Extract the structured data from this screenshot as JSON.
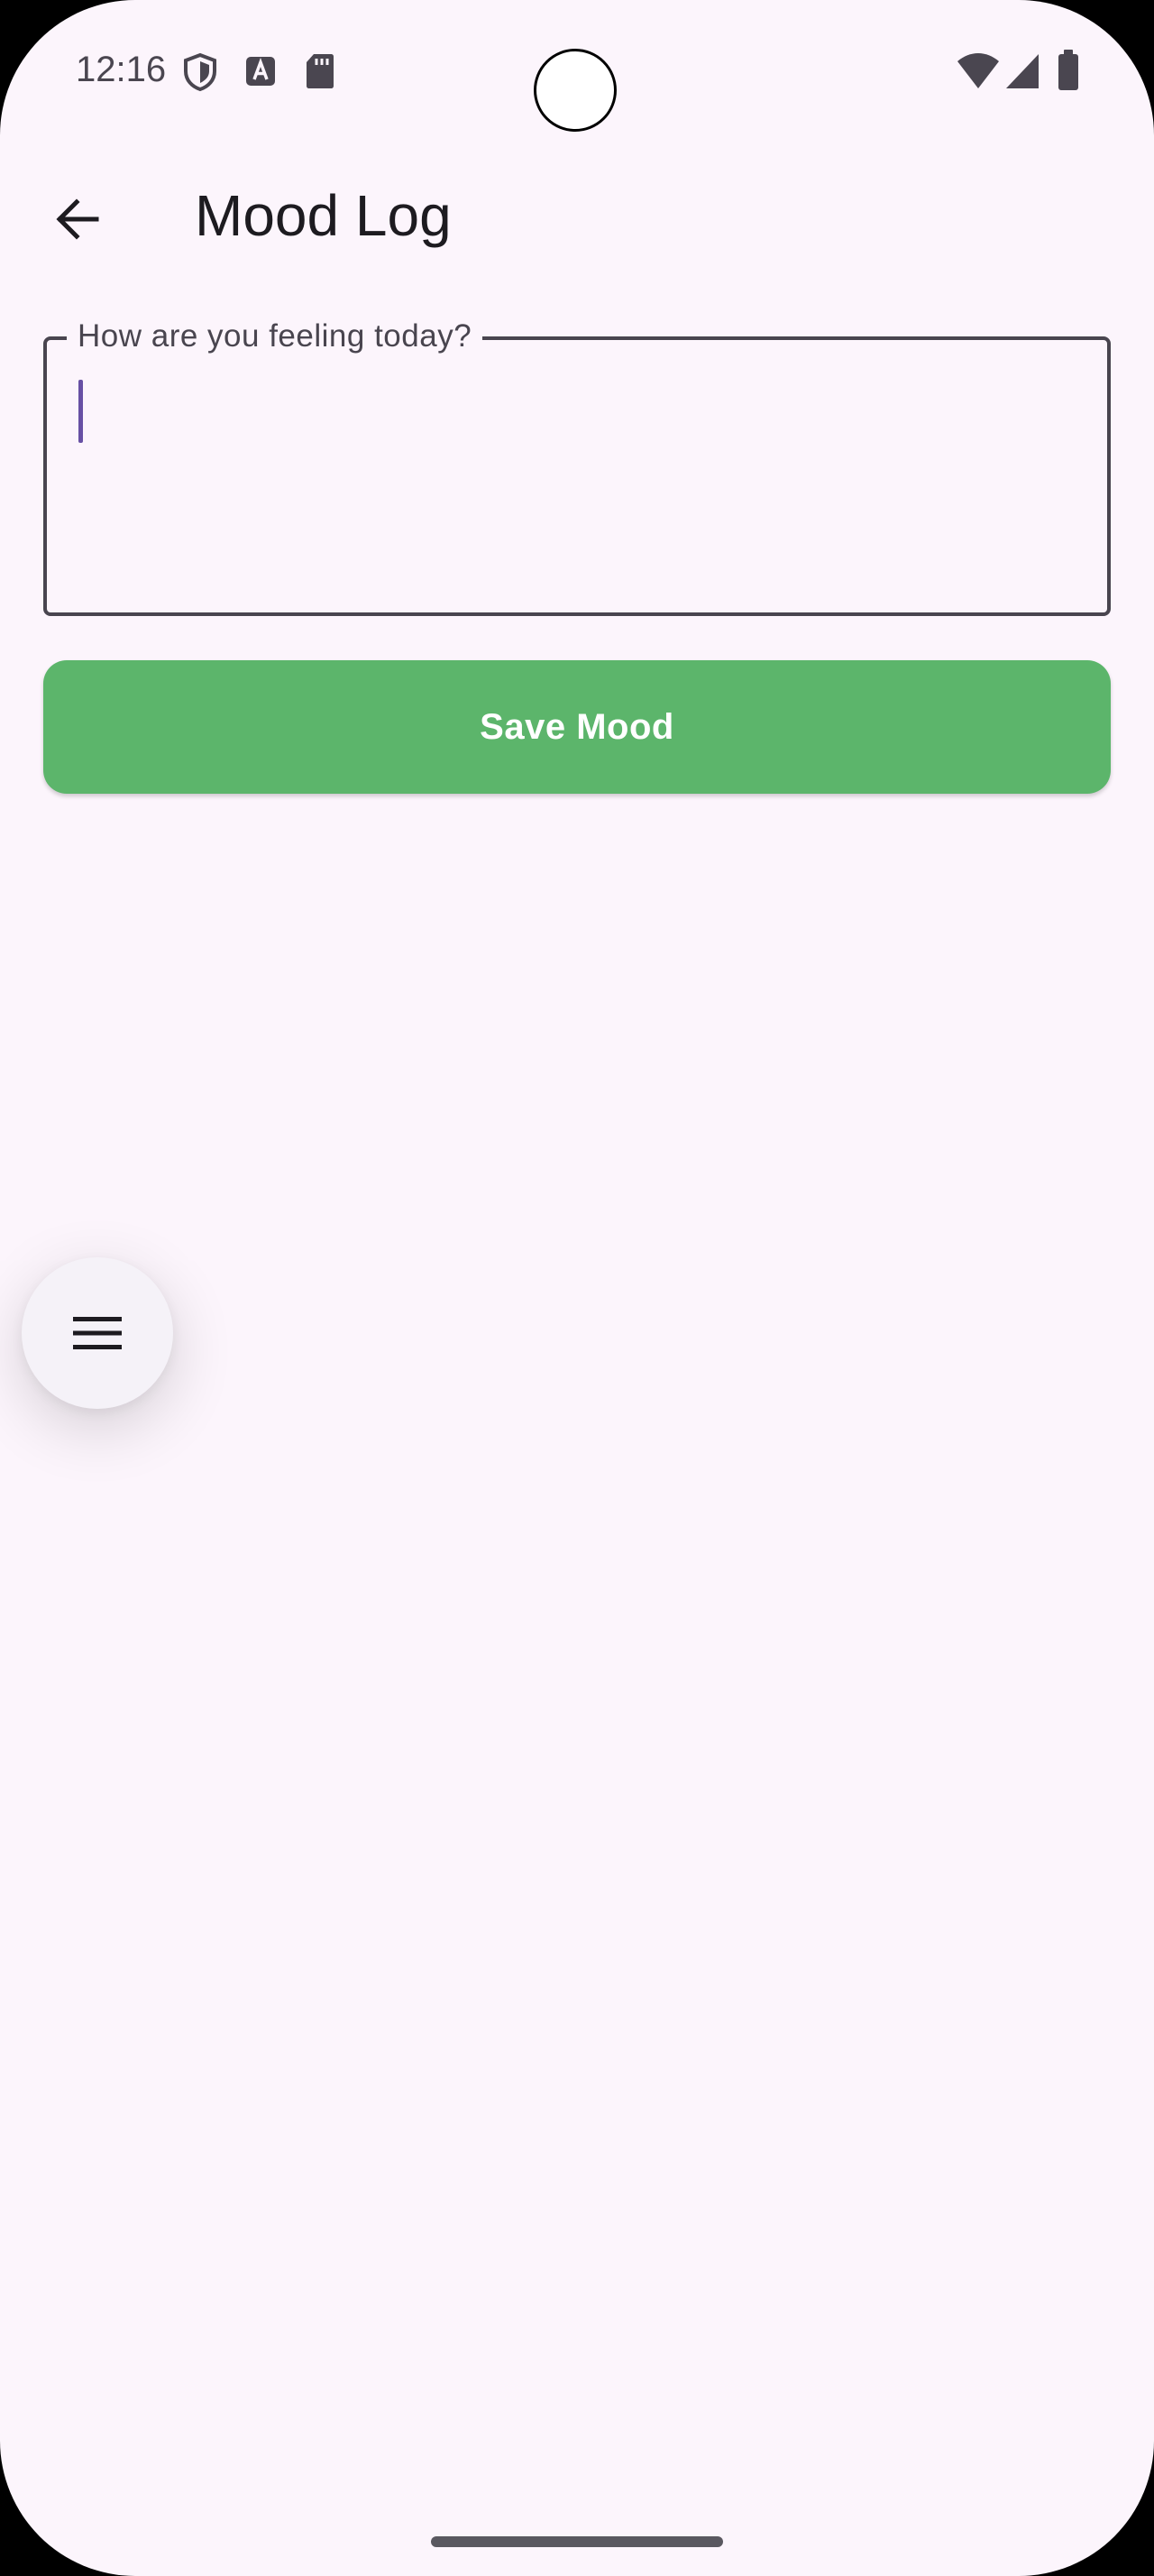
{
  "status_bar": {
    "time": "12:16",
    "left_icons": [
      "shield-icon",
      "text-app-icon",
      "sd-card-icon"
    ],
    "right_icons": [
      "wifi-icon",
      "cell-signal-icon",
      "battery-icon"
    ]
  },
  "app_bar": {
    "back_icon": "arrow-back-icon",
    "title": "Mood Log"
  },
  "mood_field": {
    "label": "How are you feeling today?",
    "value": ""
  },
  "save_button": {
    "label": "Save Mood"
  },
  "menu_fab": {
    "icon": "menu-icon"
  },
  "colors": {
    "background": "#fcf5fc",
    "save_button": "#5cb56b",
    "caret": "#6750a4",
    "field_border": "#49454f",
    "title_text": "#1d1b20"
  }
}
